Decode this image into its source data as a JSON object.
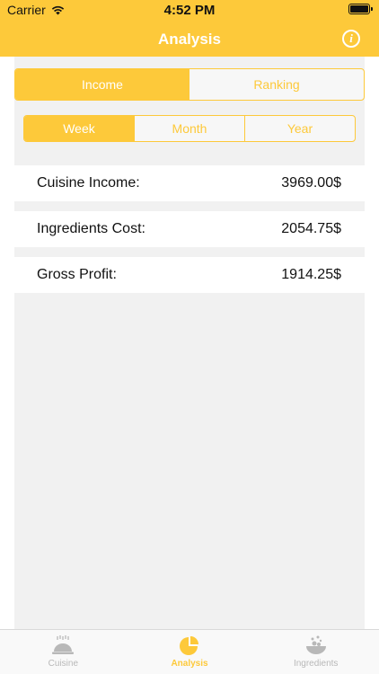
{
  "status": {
    "carrier": "Carrier",
    "time": "4:52 PM"
  },
  "nav": {
    "title": "Analysis"
  },
  "segments": {
    "main": [
      {
        "label": "Income",
        "active": true
      },
      {
        "label": "Ranking",
        "active": false
      }
    ],
    "period": [
      {
        "label": "Week",
        "active": true
      },
      {
        "label": "Month",
        "active": false
      },
      {
        "label": "Year",
        "active": false
      }
    ]
  },
  "rows": [
    {
      "label": "Cuisine Income:",
      "value": "3969.00$"
    },
    {
      "label": "Ingredients Cost:",
      "value": "2054.75$"
    },
    {
      "label": "Gross Profit:",
      "value": "1914.25$"
    }
  ],
  "tabs": [
    {
      "label": "Cuisine",
      "icon": "cloche-icon",
      "active": false
    },
    {
      "label": "Analysis",
      "icon": "pie-chart-icon",
      "active": true
    },
    {
      "label": "Ingredients",
      "icon": "ingredients-bowl-icon",
      "active": false
    }
  ],
  "colors": {
    "accent": "#fdc93a",
    "background": "#f1f1f1",
    "inactive": "#b8b8b8"
  }
}
